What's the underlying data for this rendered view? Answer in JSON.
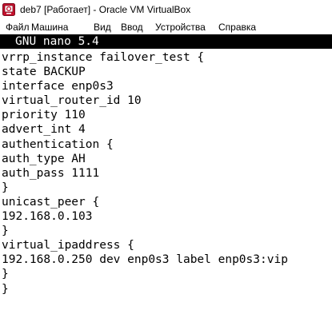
{
  "window": {
    "title": "deb7 [Работает] - Oracle VM VirtualBox",
    "icon": "virtualbox-vm-icon"
  },
  "menu": {
    "items": [
      "Файл",
      "Машина",
      "Вид",
      "Ввод",
      "Устройства",
      "Справка"
    ]
  },
  "nano": {
    "header": "GNU nano 5.4",
    "lines": [
      "vrrp_instance failover_test {",
      "state BACKUP",
      "interface enp0s3",
      "virtual_router_id 10",
      "priority 110",
      "advert_int 4",
      "authentication {",
      "auth_type AH",
      "auth_pass 1111",
      "}",
      "unicast_peer {",
      "192.168.0.103",
      "}",
      "virtual_ipaddress {",
      "192.168.0.250 dev enp0s3 label enp0s3:vip",
      "}",
      "}"
    ]
  },
  "colors": {
    "header_bg": "#000000",
    "header_fg": "#ffffff",
    "text": "#000000",
    "background": "#ffffff"
  }
}
